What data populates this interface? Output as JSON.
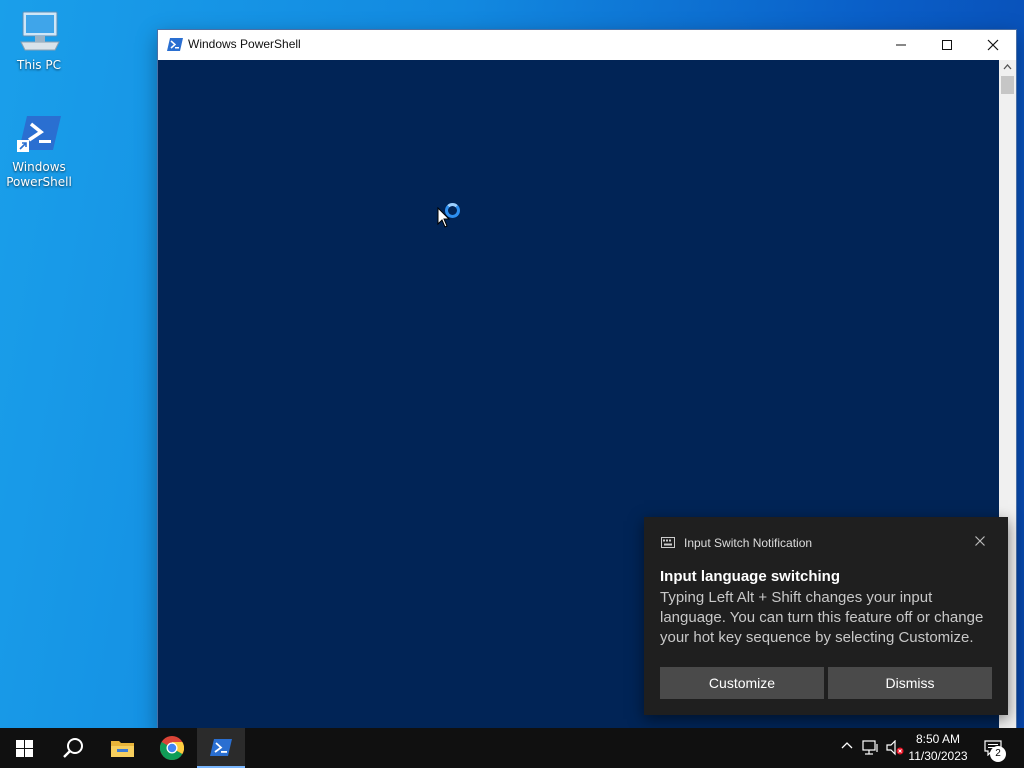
{
  "desktop": {
    "icons": [
      {
        "label": "This PC"
      },
      {
        "label": "Windows PowerShell"
      }
    ]
  },
  "window": {
    "title": "Windows PowerShell",
    "background": "#012456"
  },
  "toast": {
    "app_name": "Input Switch Notification",
    "heading": "Input language switching",
    "body": "Typing Left Alt + Shift changes your input language. You can turn this feature off or change your hot key sequence by selecting Customize.",
    "buttons": {
      "customize": "Customize",
      "dismiss": "Dismiss"
    }
  },
  "taskbar": {
    "items": [
      "start-icon",
      "search-icon",
      "file-explorer-icon",
      "chrome-icon",
      "powershell-icon"
    ],
    "active": "powershell-icon",
    "clock": {
      "time": "8:50 AM",
      "date": "11/30/2023"
    },
    "notification_count": "2"
  }
}
